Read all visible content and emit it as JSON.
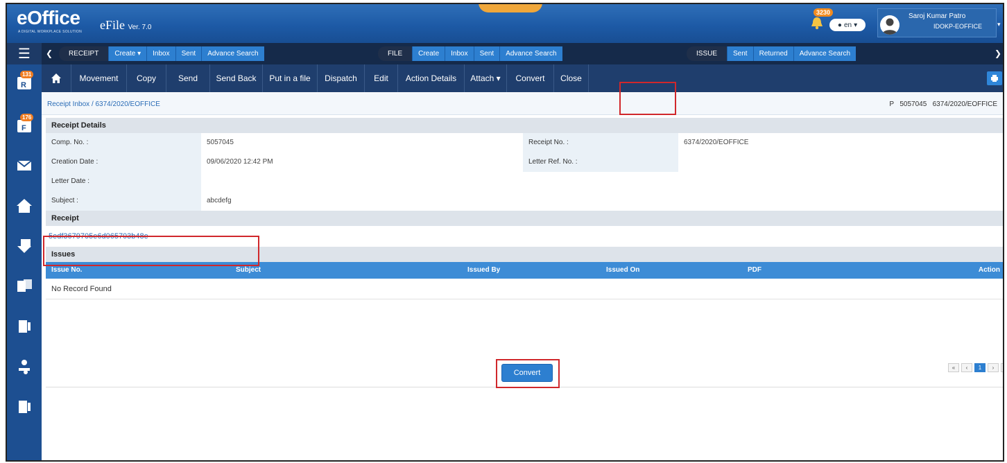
{
  "header": {
    "logo": "eOffice",
    "logo_tagline": "A DIGITAL WORKPLACE SOLUTION",
    "app_name": "eFile",
    "version": "Ver. 7.0",
    "notification_count": "3230",
    "language": "en",
    "user_name": "Saroj Kumar Patro",
    "user_role": "IDOKP-EOFFICE"
  },
  "modules": {
    "receipt": {
      "label": "RECEIPT",
      "links": [
        "Create ▾",
        "Inbox",
        "Sent",
        "Advance Search"
      ]
    },
    "file": {
      "label": "FILE",
      "links": [
        "Create",
        "Inbox",
        "Sent",
        "Advance Search"
      ]
    },
    "issue": {
      "label": "ISSUE",
      "links": [
        "Sent",
        "Returned",
        "Advance Search"
      ]
    }
  },
  "sidebar": {
    "badges": [
      "131",
      "176"
    ]
  },
  "toolbar": {
    "items": [
      "Movement",
      "Copy",
      "Send",
      "Send Back",
      "Put in a file",
      "Dispatch",
      "Edit",
      "Action Details",
      "Attach ▾",
      "Convert",
      "Close"
    ]
  },
  "breadcrumb": {
    "root": "Receipt Inbox",
    "separator": "/",
    "current": "6374/2020/EOFFICE",
    "right_prefix": "P",
    "right_comp": "5057045",
    "right_receipt": "6374/2020/EOFFICE"
  },
  "receipt_details": {
    "title": "Receipt Details",
    "comp_no_label": "Comp. No. :",
    "comp_no": "5057045",
    "receipt_no_label": "Receipt No. :",
    "receipt_no": "6374/2020/EOFFICE",
    "creation_date_label": "Creation Date :",
    "creation_date": "09/06/2020 12:42 PM",
    "letter_ref_label": "Letter Ref. No. :",
    "letter_ref": "",
    "letter_date_label": "Letter Date :",
    "letter_date": "",
    "subject_label": "Subject :",
    "subject": "abcdefg"
  },
  "receipt": {
    "title": "Receipt",
    "file_link": "5edf3679705e6d065703b48e"
  },
  "issues": {
    "title": "Issues",
    "columns": [
      "Issue No.",
      "Subject",
      "Issued By",
      "Issued On",
      "PDF",
      "Action"
    ],
    "empty": "No Record Found"
  },
  "pager": {
    "current": "1"
  },
  "convert_button": "Convert",
  "colors": {
    "accent": "#2d7fd0",
    "highlight": "#d0272b",
    "header": "#1d5aa6"
  }
}
